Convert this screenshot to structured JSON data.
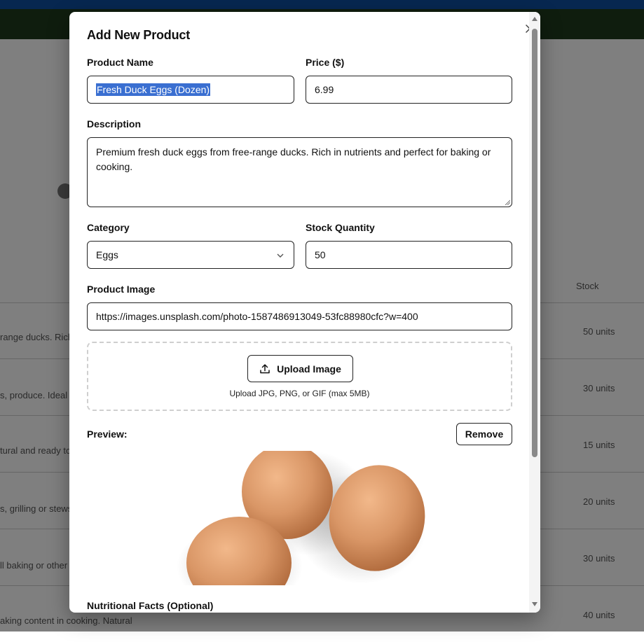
{
  "background": {
    "stock_header": "Stock",
    "rows": [
      {
        "desc": "range ducks. Rich",
        "units": "50 units"
      },
      {
        "desc": "s, produce. Ideal fo",
        "units": "30 units"
      },
      {
        "desc": "tural and ready to",
        "units": "15 units"
      },
      {
        "desc": "s, grilling or stews",
        "units": "20 units"
      },
      {
        "desc": "ll baking or other",
        "units": "30 units"
      },
      {
        "desc": "aking content in cooking. Natural",
        "units": "40 units"
      }
    ]
  },
  "modal": {
    "title": "Add New Product",
    "close_icon": "close-icon",
    "product_name_label": "Product Name",
    "product_name_value": "Fresh Duck Eggs (Dozen)",
    "price_label": "Price ($)",
    "price_value": "6.99",
    "description_label": "Description",
    "description_value": "Premium fresh duck eggs from free-range ducks. Rich in nutrients and perfect for baking or cooking.",
    "category_label": "Category",
    "category_value": "Eggs",
    "stock_label": "Stock Quantity",
    "stock_value": "50",
    "image_label": "Product Image",
    "image_url": "https://images.unsplash.com/photo-1587486913049-53fc88980cfc?w=400",
    "upload_button": "Upload Image",
    "upload_hint": "Upload JPG, PNG, or GIF (max 5MB)",
    "preview_label": "Preview:",
    "remove_button": "Remove",
    "nutrition_label": "Nutritional Facts (Optional)"
  },
  "colors": {
    "topbar": "#0f4fa0",
    "navbar": "#1f3a1c",
    "selection": "#3a6fd1",
    "egg": "#d99666"
  }
}
